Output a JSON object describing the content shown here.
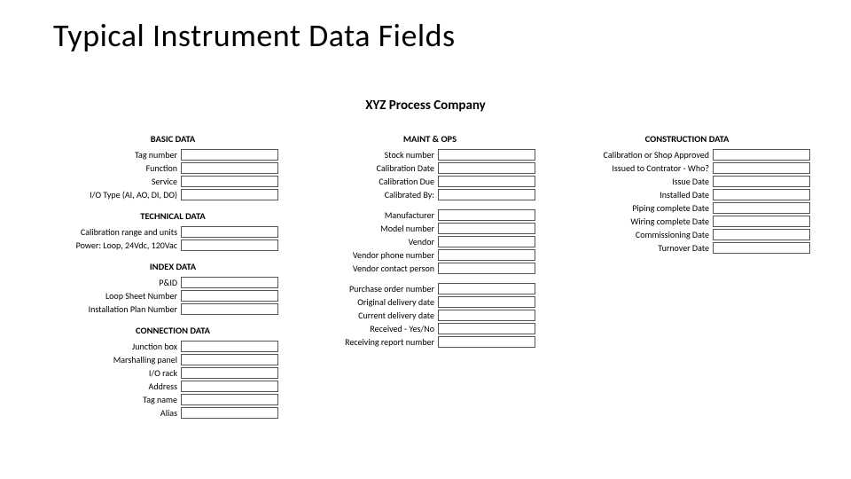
{
  "title": "Typical Instrument Data Fields",
  "company": "XYZ Process Company",
  "col1": {
    "basic_head": "BASIC DATA",
    "basic": [
      "Tag number",
      "Function",
      "Service",
      "I/O Type (AI, AO, DI, DO)"
    ],
    "tech_head": "TECHNICAL DATA",
    "tech": [
      "Calibration range and units",
      "Power: Loop, 24Vdc, 120Vac"
    ],
    "index_head": "INDEX DATA",
    "index": [
      "P&ID",
      "Loop Sheet Number",
      "Installation Plan Number"
    ],
    "conn_head": "CONNECTION DATA",
    "conn": [
      "Junction box",
      "Marshalling panel",
      "I/O rack",
      "Address",
      "Tag name",
      "Alias"
    ]
  },
  "col2": {
    "mo_head": "MAINT & OPS",
    "mo1": [
      "Stock number",
      "Calibration Date",
      "Calibration Due",
      "Calibrated By:"
    ],
    "mo2": [
      "Manufacturer",
      "Model number",
      "Vendor",
      "Vendor phone number",
      "Vendor contact person"
    ],
    "mo3": [
      "Purchase order number",
      "Original delivery date",
      "Current delivery date",
      "Received - Yes/No",
      "Receiving report number"
    ]
  },
  "col3": {
    "cons_head": "CONSTRUCTION DATA",
    "cons": [
      "Calibration or Shop Approved",
      "Issued to Contrator - Who?",
      "Issue Date",
      "Installed Date",
      "Piping complete Date",
      "Wiring complete Date",
      "Commissioning Date",
      "Turnover Date"
    ]
  }
}
